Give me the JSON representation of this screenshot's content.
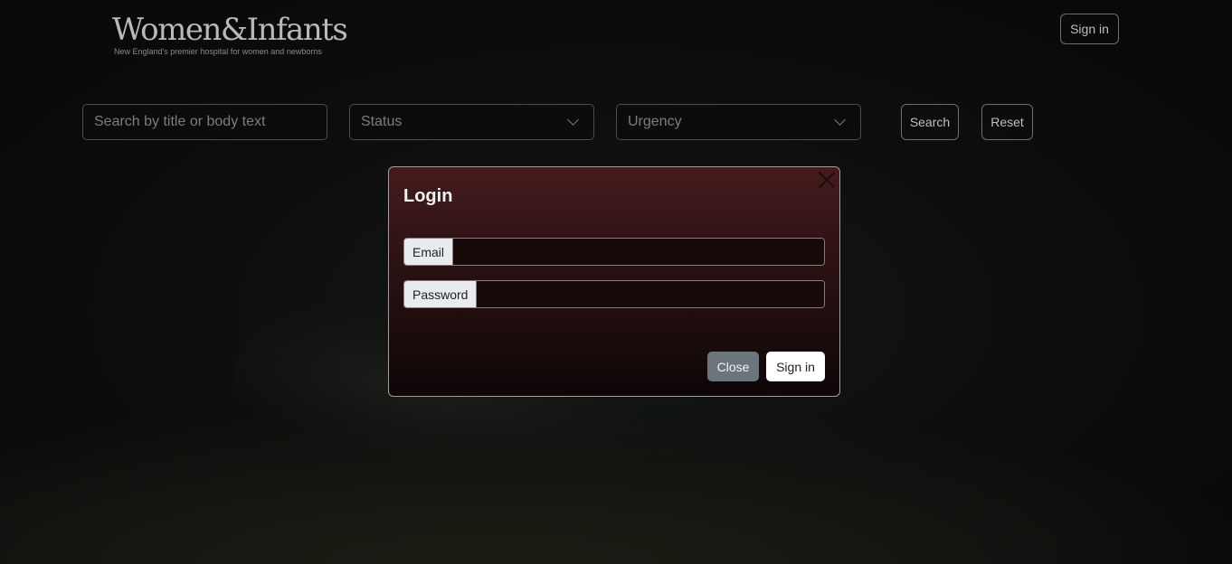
{
  "header": {
    "logo_title": "Women&Infants",
    "logo_tagline": "New England's premier hospital for women and newborns",
    "signin_label": "Sign in"
  },
  "filters": {
    "search_placeholder": "Search by title or body text",
    "status_label": "Status",
    "urgency_label": "Urgency",
    "search_button": "Search",
    "reset_button": "Reset"
  },
  "modal": {
    "title": "Login",
    "email_label": "Email",
    "email_value": "",
    "password_label": "Password",
    "password_value": "",
    "close_button": "Close",
    "signin_button": "Sign in"
  },
  "colors": {
    "modal_top": "#441b1c",
    "modal_bottom": "#0d0707",
    "close_button_bg": "#6c757d",
    "signin_button_bg": "#ffffff"
  }
}
